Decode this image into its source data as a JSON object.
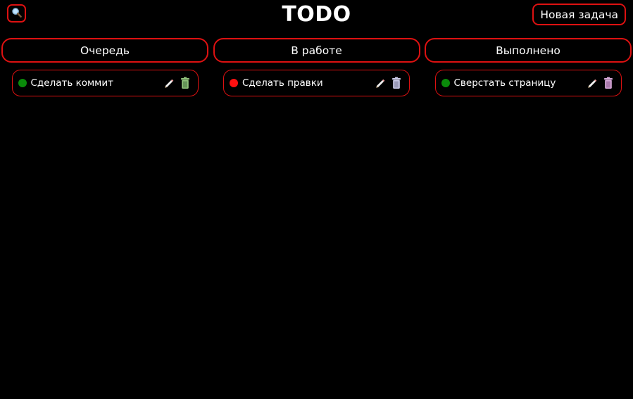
{
  "header": {
    "title": "TODO",
    "new_task_label": "Новая задача",
    "search_icon": "search-icon"
  },
  "colors": {
    "accent": "#dd1111",
    "background": "#000000",
    "status_ok": "#0a8a0a",
    "status_alert": "#ff1111"
  },
  "columns": [
    {
      "title": "Очередь",
      "tasks": [
        {
          "label": "Сделать коммит",
          "status_color": "#0a8a0a",
          "trash_tint": "#8fbf7a"
        }
      ]
    },
    {
      "title": "В работе",
      "tasks": [
        {
          "label": "Сделать правки",
          "status_color": "#ff1111",
          "trash_tint": "#c9c9e6"
        }
      ]
    },
    {
      "title": "Выполнено",
      "tasks": [
        {
          "label": "Сверстать страницу",
          "status_color": "#0a8a0a",
          "trash_tint": "#d6a8d8"
        }
      ]
    }
  ]
}
